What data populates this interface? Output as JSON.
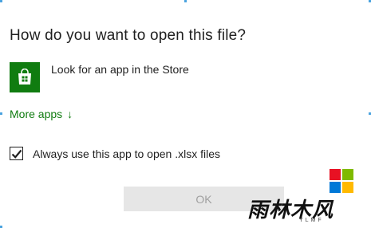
{
  "dialog": {
    "title": "How do you want to open this file?",
    "store_option": {
      "label": "Look for an app in the Store",
      "icon": "store-bag-icon",
      "tile_color": "#107c10"
    },
    "more_apps": {
      "label": "More apps",
      "arrow": "↓",
      "color": "#107c10"
    },
    "always_use": {
      "label": "Always use this app to open .xlsx files",
      "checked": true
    },
    "ok_button": {
      "label": "OK",
      "enabled": false
    }
  },
  "watermark": {
    "text": "雨林木风",
    "subtext": "YLMF",
    "logo_colors": [
      "#e81123",
      "#7fba00",
      "#0078d7",
      "#ffb900"
    ]
  }
}
